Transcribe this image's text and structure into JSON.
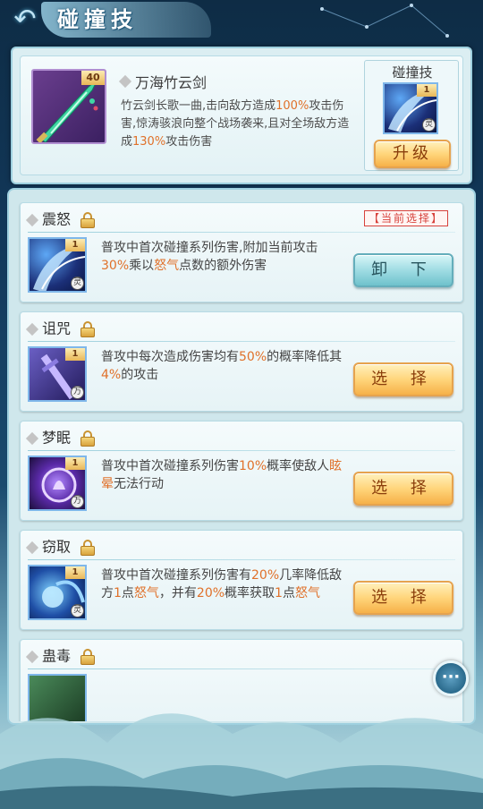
{
  "header": {
    "title": "碰撞技",
    "back_icon": "back-arrow-icon"
  },
  "weapon": {
    "name": "万海竹云剑",
    "level": "40",
    "desc_parts": [
      {
        "t": "竹云剑长歌一曲,击向敌方造成",
        "hl": false
      },
      {
        "t": "100%",
        "hl": true
      },
      {
        "t": "攻击伤害,惊涛骇浪向整个战场袭来,且对全场敌方造成",
        "hl": false
      },
      {
        "t": "130%",
        "hl": true
      },
      {
        "t": "攻击伤害",
        "hl": false
      }
    ]
  },
  "current_skill": {
    "title": "碰撞技",
    "level": "1",
    "badge": "灵",
    "upgrade_label": "升级"
  },
  "current_tag": "当前选择",
  "skills": [
    {
      "name": "震怒",
      "level": "1",
      "badge": "灵",
      "action": "卸 下",
      "current": true,
      "desc_parts": [
        {
          "t": "普攻中首次碰撞系列伤害,附加当前攻击",
          "hl": false
        },
        {
          "t": "30%",
          "hl": true
        },
        {
          "t": "乘以",
          "hl": false
        },
        {
          "t": "怒气",
          "hl": true
        },
        {
          "t": "点数的额外伤害",
          "hl": false
        }
      ]
    },
    {
      "name": "诅咒",
      "level": "1",
      "badge": "万",
      "action": "选 择",
      "current": false,
      "desc_parts": [
        {
          "t": "普攻中每次造成伤害均有",
          "hl": false
        },
        {
          "t": "50%",
          "hl": true
        },
        {
          "t": "的概率降低其",
          "hl": false
        },
        {
          "t": "4%",
          "hl": true
        },
        {
          "t": "的攻击",
          "hl": false
        }
      ]
    },
    {
      "name": "梦眠",
      "level": "1",
      "badge": "万",
      "action": "选 择",
      "current": false,
      "desc_parts": [
        {
          "t": "普攻中首次碰撞系列伤害",
          "hl": false
        },
        {
          "t": "10%",
          "hl": true
        },
        {
          "t": "概率使敌人",
          "hl": false
        },
        {
          "t": "眩晕",
          "hl": true
        },
        {
          "t": "无法行动",
          "hl": false
        }
      ]
    },
    {
      "name": "窃取",
      "level": "1",
      "badge": "灵",
      "action": "选 择",
      "current": false,
      "desc_parts": [
        {
          "t": "普攻中首次碰撞系列伤害有",
          "hl": false
        },
        {
          "t": "20%",
          "hl": true
        },
        {
          "t": "几率降低敌方",
          "hl": false
        },
        {
          "t": "1",
          "hl": true
        },
        {
          "t": "点",
          "hl": false
        },
        {
          "t": "怒气",
          "hl": true
        },
        {
          "t": "，并有",
          "hl": false
        },
        {
          "t": "20%",
          "hl": true
        },
        {
          "t": "概率获取",
          "hl": false
        },
        {
          "t": "1",
          "hl": true
        },
        {
          "t": "点",
          "hl": false
        },
        {
          "t": "怒气",
          "hl": true
        }
      ]
    },
    {
      "name": "蛊毒",
      "level": "",
      "badge": "",
      "action": "",
      "current": false,
      "desc_parts": []
    }
  ],
  "colors": {
    "highlight": "#e0712a",
    "current_tag": "#d7423c",
    "gold_button": "#ffd57b",
    "blue_button": "#9fdce3"
  },
  "chat_icon": "chat-bubble-icon"
}
